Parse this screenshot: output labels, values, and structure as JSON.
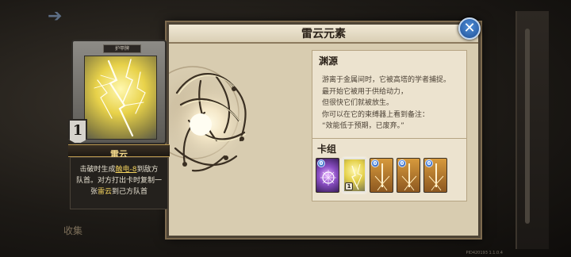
{
  "panel": {
    "title": "雷云元素"
  },
  "lore": {
    "title": "渊源",
    "lines": [
      "游离于金属间时，它被高塔的学者捕捉。",
      "最开始它被用于供给动力，",
      "但很快它们就被放生。",
      "你可以在它的束缚器上看到备注：",
      "“效能低于预期，已废弃。”"
    ]
  },
  "deck": {
    "title": "卡组",
    "cards": [
      {
        "cost": "0",
        "count": "",
        "theme": "#6a3fa0",
        "icon": "spark-orb-icon"
      },
      {
        "cost": "",
        "count": "1",
        "theme": "#d8c84a",
        "icon": "lightning-cloud-icon",
        "selected": true
      },
      {
        "cost": "0",
        "count": "",
        "theme": "#c68a2e",
        "icon": "sword-burst-icon"
      },
      {
        "cost": "0",
        "count": "",
        "theme": "#c68a2e",
        "icon": "sword-burst-icon"
      },
      {
        "cost": "0",
        "count": "",
        "theme": "#c68a2e",
        "icon": "sword-burst-icon"
      }
    ]
  },
  "card": {
    "tag": "护甲牌",
    "cost": "1",
    "name": "雷云",
    "text_a": "击破时生成",
    "text_kw1": "触电-8",
    "text_b": "到敌方",
    "text_c": "队首。对方打出卡时复制一",
    "text_d": "张",
    "text_kw2": "雷云",
    "text_e": "到己方队首"
  },
  "background": {
    "label": "收集"
  },
  "footer": {
    "pid": "PID420193 1.1.0.4"
  },
  "colors": {
    "panel": "#d8ccb0",
    "keyword": "#f4d35e",
    "close_button": "#2f6cc0"
  }
}
